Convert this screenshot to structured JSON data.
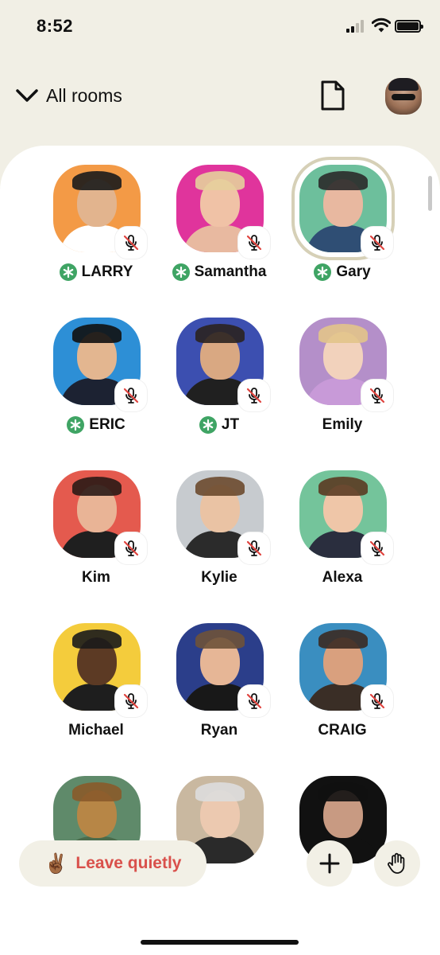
{
  "status_bar": {
    "time": "8:52"
  },
  "header": {
    "back_label": "All rooms"
  },
  "speakers": [
    {
      "name": "LARRY",
      "moderator": true,
      "muted": true,
      "bg": "#f39a46",
      "skin": "#e2b48e",
      "hair": "#1b1b1b",
      "shirt": "#ffffff",
      "speaking": false
    },
    {
      "name": "Samantha",
      "moderator": true,
      "muted": true,
      "bg": "#e0349c",
      "skin": "#f0c2a6",
      "hair": "#e6cf9c",
      "shirt": "#e8b9a0",
      "speaking": false
    },
    {
      "name": "Gary",
      "moderator": true,
      "muted": true,
      "bg": "#6dbf9c",
      "skin": "#e8b8a0",
      "hair": "#2a2a2a",
      "shirt": "#2f4e74",
      "speaking": true
    },
    {
      "name": "ERIC",
      "moderator": true,
      "muted": true,
      "bg": "#2d8fd6",
      "skin": "#e3b690",
      "hair": "#111111",
      "shirt": "#1c2232",
      "speaking": false
    },
    {
      "name": "JT",
      "moderator": true,
      "muted": true,
      "bg": "#3c4fb0",
      "skin": "#d9a882",
      "hair": "#2a2220",
      "shirt": "#202020",
      "speaking": false
    },
    {
      "name": "Emily",
      "moderator": false,
      "muted": true,
      "bg": "#b48fc9",
      "skin": "#f2d2bc",
      "hair": "#e2c48a",
      "shirt": "#c89ad8",
      "speaking": false
    },
    {
      "name": "Kim",
      "moderator": false,
      "muted": true,
      "bg": "#e45a4e",
      "skin": "#e9b496",
      "hair": "#2a1a16",
      "shirt": "#1f1f1f",
      "speaking": false
    },
    {
      "name": "Kylie",
      "moderator": false,
      "muted": true,
      "bg": "#c7cbcf",
      "skin": "#eac3a4",
      "hair": "#6b4a2e",
      "shirt": "#2b2b2b",
      "speaking": false
    },
    {
      "name": "Alexa",
      "moderator": false,
      "muted": true,
      "bg": "#74c49b",
      "skin": "#efc6a8",
      "hair": "#5b3b22",
      "shirt": "#2a2e3e",
      "speaking": false
    },
    {
      "name": "Michael",
      "moderator": false,
      "muted": true,
      "bg": "#f4cc3c",
      "skin": "#5c3a24",
      "hair": "#1b1b1b",
      "shirt": "#1e1e1e",
      "speaking": false
    },
    {
      "name": "Ryan",
      "moderator": false,
      "muted": true,
      "bg": "#2b3e8a",
      "skin": "#e6b696",
      "hair": "#6e5238",
      "shirt": "#181818",
      "speaking": false
    },
    {
      "name": "CRAIG",
      "moderator": false,
      "muted": true,
      "bg": "#3a8ec0",
      "skin": "#d9a07e",
      "hair": "#3b2a22",
      "shirt": "#3a2e26",
      "speaking": false
    },
    {
      "name": "",
      "moderator": false,
      "muted": false,
      "bg": "#5f8a6a",
      "skin": "#b78646",
      "hair": "#8a5a2a",
      "shirt": "#4b6b4b",
      "speaking": false
    },
    {
      "name": "",
      "moderator": false,
      "muted": false,
      "bg": "#c9b8a0",
      "skin": "#ecc9b0",
      "hair": "#dddddd",
      "shirt": "#2a2a2a",
      "speaking": false
    },
    {
      "name": "",
      "moderator": false,
      "muted": false,
      "bg": "#111111",
      "skin": "#c89a82",
      "hair": "#111111",
      "shirt": "#111111",
      "speaking": false
    }
  ],
  "bottom_bar": {
    "leave_emoji": "✌🏾",
    "leave_label": "Leave quietly"
  },
  "colors": {
    "app_bg": "#f1efe5",
    "card_bg": "#ffffff",
    "leave_red": "#d9504b",
    "moderator_green": "#3fa464"
  }
}
